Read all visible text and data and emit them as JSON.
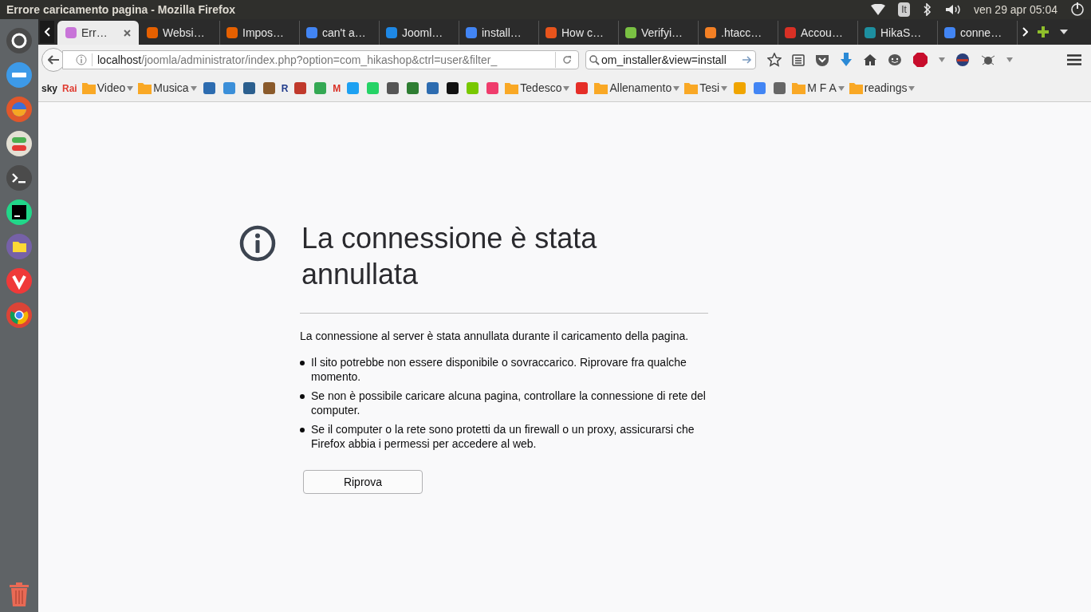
{
  "window": {
    "title": "Errore caricamento pagina - Mozilla Firefox"
  },
  "top_panel": {
    "keyboard": "It",
    "clock": "ven 29 apr 05:04"
  },
  "launcher": [
    {
      "kind": "ubuntu",
      "color": "#4a4a4a"
    },
    {
      "kind": "dots",
      "color": "#3d9ae8"
    },
    {
      "kind": "firefox",
      "color": "#e0572b"
    },
    {
      "kind": "toggles",
      "color": "#e4e0d4"
    },
    {
      "kind": "terminal",
      "color": "#4b4b4b"
    },
    {
      "kind": "pycharm",
      "color": "#21d789"
    },
    {
      "kind": "files",
      "color": "#7661a8"
    },
    {
      "kind": "vivaldi",
      "color": "#ef3939"
    },
    {
      "kind": "chrome",
      "color": "#db4437"
    }
  ],
  "tabs": [
    {
      "title": "Err…",
      "selected": true,
      "color": "#c874d8"
    },
    {
      "title": "Websi…",
      "selected": false,
      "color": "#e66000"
    },
    {
      "title": "Impos…",
      "selected": false,
      "color": "#e66000"
    },
    {
      "title": "can't a…",
      "selected": false,
      "color": "#4285f4"
    },
    {
      "title": "Jooml…",
      "selected": false,
      "color": "#1e88e5"
    },
    {
      "title": "install…",
      "selected": false,
      "color": "#4285f4"
    },
    {
      "title": "How c…",
      "selected": false,
      "color": "#e8541c"
    },
    {
      "title": "Verifyi…",
      "selected": false,
      "color": "#7ac143"
    },
    {
      "title": ".htacc…",
      "selected": false,
      "color": "#f48024"
    },
    {
      "title": "Accou…",
      "selected": false,
      "color": "#d93025"
    },
    {
      "title": "HikaS…",
      "selected": false,
      "color": "#1d8fa0"
    },
    {
      "title": "conne…",
      "selected": false,
      "color": "#4285f4"
    }
  ],
  "url_bar": {
    "host": "localhost",
    "path": "/joomla/administrator/index.php?option=com_hikashop&ctrl=user&filter_"
  },
  "search_bar": {
    "value": "om_installer&view=install"
  },
  "bookmarks": [
    {
      "kind": "logo",
      "label": "sky",
      "color": "#222222"
    },
    {
      "kind": "logo",
      "label": "Rai",
      "color": "#e03c31"
    },
    {
      "kind": "folder",
      "label": "Video"
    },
    {
      "kind": "folder",
      "label": "Musica"
    },
    {
      "kind": "icon",
      "color": "#2d6cb0"
    },
    {
      "kind": "icon",
      "color": "#3b8fd9"
    },
    {
      "kind": "icon",
      "color": "#2b5f8e"
    },
    {
      "kind": "icon",
      "color": "#8a5a2b"
    },
    {
      "kind": "logo",
      "label": "R",
      "color": "#1f3a8a"
    },
    {
      "kind": "icon",
      "color": "#c0392b"
    },
    {
      "kind": "icon",
      "color": "#34a853"
    },
    {
      "kind": "logo",
      "label": "M",
      "color": "#d93025"
    },
    {
      "kind": "icon",
      "color": "#1da1f2"
    },
    {
      "kind": "icon",
      "color": "#25d366"
    },
    {
      "kind": "icon",
      "color": "#555555"
    },
    {
      "kind": "icon",
      "color": "#2e7d32"
    },
    {
      "kind": "icon",
      "color": "#2d6cb0"
    },
    {
      "kind": "icon",
      "color": "#111111"
    },
    {
      "kind": "icon",
      "color": "#78c800"
    },
    {
      "kind": "icon",
      "color": "#ef3c6c"
    },
    {
      "kind": "folder",
      "label": "Tedesco"
    },
    {
      "kind": "icon",
      "color": "#e52d27"
    },
    {
      "kind": "folder",
      "label": "Allenamento"
    },
    {
      "kind": "folder",
      "label": "Tesi"
    },
    {
      "kind": "icon",
      "color": "#f0a500"
    },
    {
      "kind": "icon",
      "color": "#4285f4"
    },
    {
      "kind": "icon",
      "color": "#666666"
    },
    {
      "kind": "folder",
      "label": "M F A"
    },
    {
      "kind": "folder",
      "label": "readings"
    }
  ],
  "error": {
    "title": "La connessione è stata annullata",
    "description": "La connessione al server è stata annullata durante il caricamento della pagina.",
    "bullets": [
      "Il sito potrebbe non essere disponibile o sovraccarico. Riprovare fra qualche momento.",
      "Se non è possibile caricare alcuna pagina, controllare la connessione di rete del computer.",
      "Se il computer o la rete sono protetti da un firewall o un proxy, assicurarsi che Firefox abbia i permessi per accedere al web."
    ],
    "button": "Riprova"
  }
}
